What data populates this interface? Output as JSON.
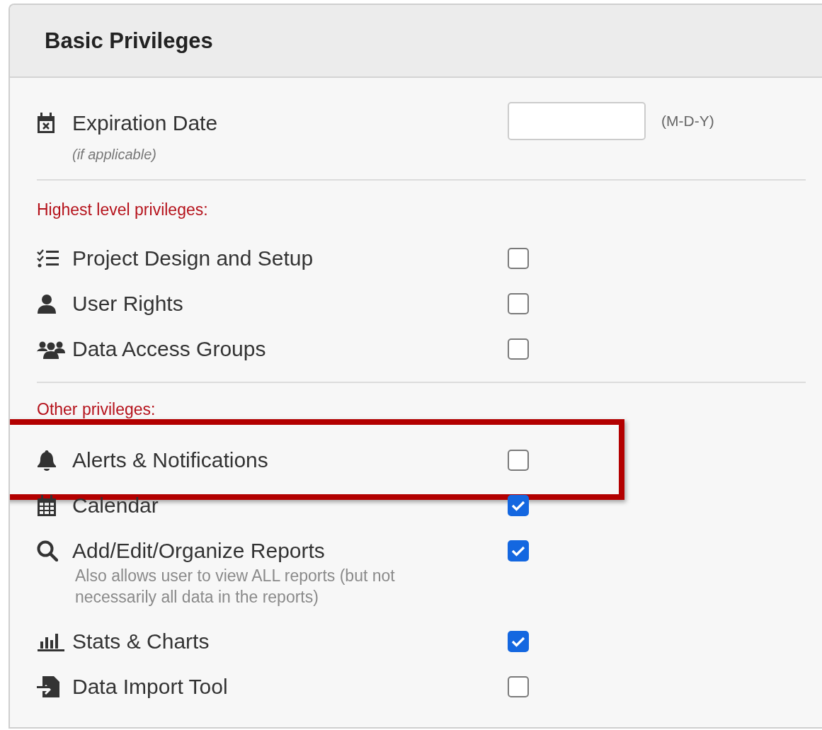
{
  "panel": {
    "title": "Basic Privileges"
  },
  "expiration": {
    "label": "Expiration Date",
    "note": "(if applicable)",
    "format_hint": "(M-D-Y)"
  },
  "sections": [
    {
      "heading": "Highest level privileges:",
      "items": [
        {
          "label": "Project Design and Setup",
          "checked": false,
          "highlighted": false
        },
        {
          "label": "User Rights",
          "checked": false,
          "highlighted": false
        },
        {
          "label": "Data Access Groups",
          "checked": false,
          "highlighted": false
        }
      ]
    },
    {
      "heading": "Other privileges:",
      "items": [
        {
          "label": "Alerts & Notifications",
          "checked": false,
          "highlighted": true
        },
        {
          "label": "Calendar",
          "checked": true,
          "highlighted": false
        },
        {
          "label": "Add/Edit/Organize Reports",
          "description": "Also allows user to view ALL reports (but not necessarily all data in the reports)",
          "checked": true,
          "highlighted": false
        },
        {
          "label": "Stats & Charts",
          "checked": true,
          "highlighted": false
        },
        {
          "label": "Data Import Tool",
          "checked": false,
          "highlighted": false
        }
      ]
    }
  ]
}
